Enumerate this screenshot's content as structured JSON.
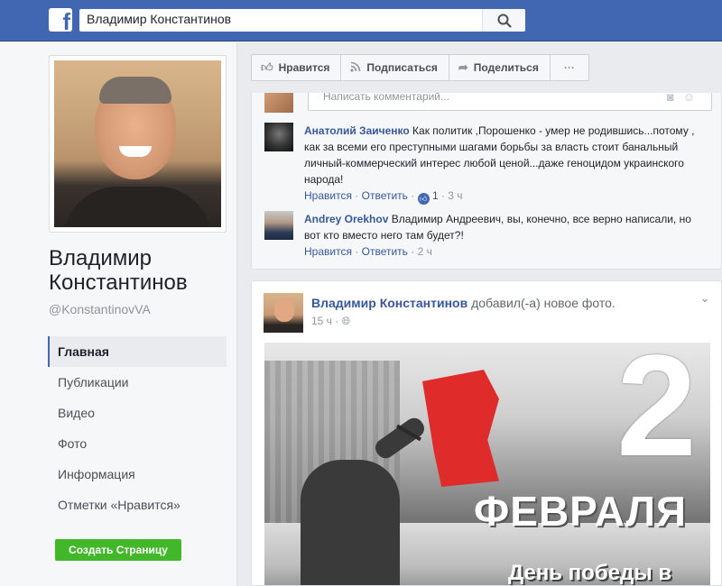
{
  "header": {
    "search_value": "Владимир Константинов"
  },
  "profile": {
    "name": "Владимир Константинов",
    "handle": "@KonstantinovVA"
  },
  "nav": {
    "items": [
      {
        "label": "Главная",
        "active": true
      },
      {
        "label": "Публикации",
        "active": false
      },
      {
        "label": "Видео",
        "active": false
      },
      {
        "label": "Фото",
        "active": false
      },
      {
        "label": "Информация",
        "active": false
      },
      {
        "label": "Отметки «Нравится»",
        "active": false
      }
    ],
    "create_page": "Создать Страницу"
  },
  "actions": {
    "like": "Нравится",
    "subscribe": "Подписаться",
    "share": "Поделиться",
    "more": "···"
  },
  "comments": {
    "compose_placeholder": "Написать комментарий...",
    "items": [
      {
        "author": "Анатолий Заиченко",
        "text": "Как политик ,Порошенко - умер не родившись...потому , как за всеми его преступными шагами борьбы за власть стоит банальный личный-коммерческий интерес любой ценой...даже геноцидом украинского народа!",
        "like": "Нравится",
        "reply": "Ответить",
        "reactions": "1",
        "time": "3 ч"
      },
      {
        "author": "Andrey Orekhov",
        "text": "Владимир Андреевич, вы, конечно, все верно написали, но вот кто вместо него там будет?!",
        "like": "Нравится",
        "reply": "Ответить",
        "time": "2 ч"
      }
    ]
  },
  "post": {
    "author": "Владимир Константинов",
    "action": "добавил(-а) новое фото.",
    "time": "15 ч",
    "image_text": {
      "number": "2",
      "month": "ФЕВРАЛЯ",
      "subtitle": "День победы в"
    }
  },
  "colors": {
    "brand": "#4267b2",
    "link": "#365899",
    "create_button": "#42b72a",
    "flag": "#e02b2b"
  }
}
